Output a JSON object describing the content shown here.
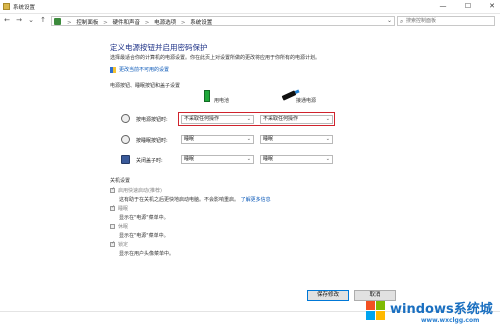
{
  "window": {
    "title": "系统设置",
    "controls": {
      "minimize": "—",
      "maximize": "☐",
      "close": "✕"
    }
  },
  "nav": {
    "back": "←",
    "forward": "→",
    "dropdown": "⌄",
    "up": "↑",
    "breadcrumbs": [
      "控制面板",
      "硬件和声音",
      "电源选项",
      "系统设置"
    ],
    "breadcrumb_sep": ">",
    "search_placeholder": "搜索控制面板"
  },
  "header": {
    "title": "定义电源按钮并启用密码保护",
    "description": "选择最适合你的计算机的电源设置。你在此页上对设置所做的更改将应用于你所有的电源计划。",
    "change_link": "更改当前不可用的设置"
  },
  "power_section": {
    "label": "电源按钮、睡眠按钮和盖子设置",
    "col_battery": "用电池",
    "col_plugged": "接通电源",
    "rows": [
      {
        "label": "按电源按钮时:",
        "battery": "不采取任何操作",
        "plugged": "不采取任何操作",
        "icon": "power-button-icon"
      },
      {
        "label": "按睡眠按钮时:",
        "battery": "睡眠",
        "plugged": "睡眠",
        "icon": "sleep-button-icon"
      },
      {
        "label": "关闭盖子时:",
        "battery": "睡眠",
        "plugged": "睡眠",
        "icon": "laptop-lid-icon"
      }
    ]
  },
  "shutdown_section": {
    "label": "关机设置",
    "items": [
      {
        "title": "启用快速启动(推荐)",
        "desc": "这有助于在关机之后更快地启动电脑。不会影响重启。",
        "link": "了解更多信息",
        "checked": true
      },
      {
        "title": "睡眠",
        "desc": "显示在\"电源\"菜单中。",
        "checked": true
      },
      {
        "title": "休眠",
        "desc": "显示在\"电源\"菜单中。",
        "checked": false
      },
      {
        "title": "锁定",
        "desc": "显示在用户头像菜单中。",
        "checked": true
      }
    ]
  },
  "footer": {
    "save": "保存修改",
    "cancel": "取消"
  },
  "watermark": {
    "brand": "windows系统城",
    "url": "www.wxclgg.com"
  },
  "colors": {
    "title_blue": "#1e3287",
    "link_blue": "#0a58b8",
    "highlight_red": "#d0232d",
    "battery_green": "#1fa83a"
  }
}
